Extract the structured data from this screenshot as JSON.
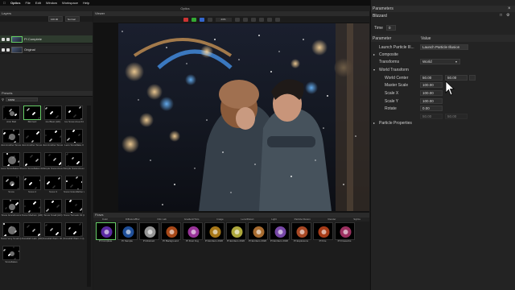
{
  "menubar": {
    "app": "Optics",
    "items": [
      "File",
      "Edit",
      "Window",
      "Workspace",
      "Help"
    ],
    "clock": "Mon Nov 21 11:38 AM"
  },
  "title": "Optics",
  "layers": {
    "header": "Layers",
    "zoom": "100.00",
    "blend": "Normal",
    "items": [
      {
        "label": "PI Complete",
        "selected": true
      },
      {
        "label": "Original",
        "selected": false
      }
    ]
  },
  "presets": {
    "header": "Presets",
    "search": "snow",
    "items": [
      "Artic Ball",
      "Blizzard",
      "Ice Blast (HD)",
      "Ice Snow Area 04",
      "Just Another Snow 01",
      "Just Another Snow 0",
      "Just Another Snow 03",
      "Lens Snowflake 0",
      "Lens Snowflakes 01",
      "Lens Snowflakes 02",
      "Simple Snow Area 01",
      "Simple Snow Area 2",
      "Snow",
      "Snow 2",
      "Snow 3",
      "Snow Grandfather 2",
      "Snow Grandmoms",
      "Snow Medium (HD)",
      "Snow Small (HD)",
      "Snow Tornado 02 (HD)",
      "Snow Very Small (HD)",
      "Snowfall Calm (HD)",
      "Snowfall Warm 02 (HD)",
      "Snowfall Warm 1 (HD)",
      "Snowflakes"
    ]
  },
  "viewer": {
    "header": "Viewer",
    "zoom": "23%"
  },
  "flows": {
    "header": "Flows",
    "tabs": [
      "Color",
      "Diffusion/Blur",
      "Film Lab",
      "Gradient/Tints",
      "Image",
      "Lens/Distort",
      "Light",
      "Particle Illusion",
      "Render",
      "Stylize"
    ],
    "items": [
      "PI Complete",
      "PI Sample",
      "PI Abstract",
      "PI Background",
      "PI Dust Fog",
      "PI Emitters 2020",
      "PI Emitters 2020",
      "PI Emitters 2020",
      "PI Emitters 2020",
      "PI Explosions",
      "PI Fire",
      "PI Fireworks"
    ]
  },
  "params": {
    "header": "Parameters",
    "subtitle": "Blizzard",
    "time_label": "Time",
    "time_value": "0",
    "col_param": "Parameter",
    "col_value": "Value",
    "rows": {
      "launch": "Launch Particle Ill...",
      "launch_btn": "Launch Particle Illusion",
      "composite": "Composite",
      "transforms": "Transforms",
      "transforms_val": "World",
      "world_transform": "World Transform",
      "world_center": "World Center",
      "wc_x": "50.00",
      "wc_y": "50.00",
      "master_scale": "Master Scale",
      "master_scale_val": "100.00",
      "scale_x": "Scale X",
      "scale_x_val": "100.00",
      "scale_y": "Scale Y",
      "scale_y_val": "100.00",
      "rotate": "Rotate",
      "rotate_val": "0.00",
      "extra_x": "50.00",
      "extra_y": "50.00",
      "particle_props": "Particle Properties"
    }
  }
}
